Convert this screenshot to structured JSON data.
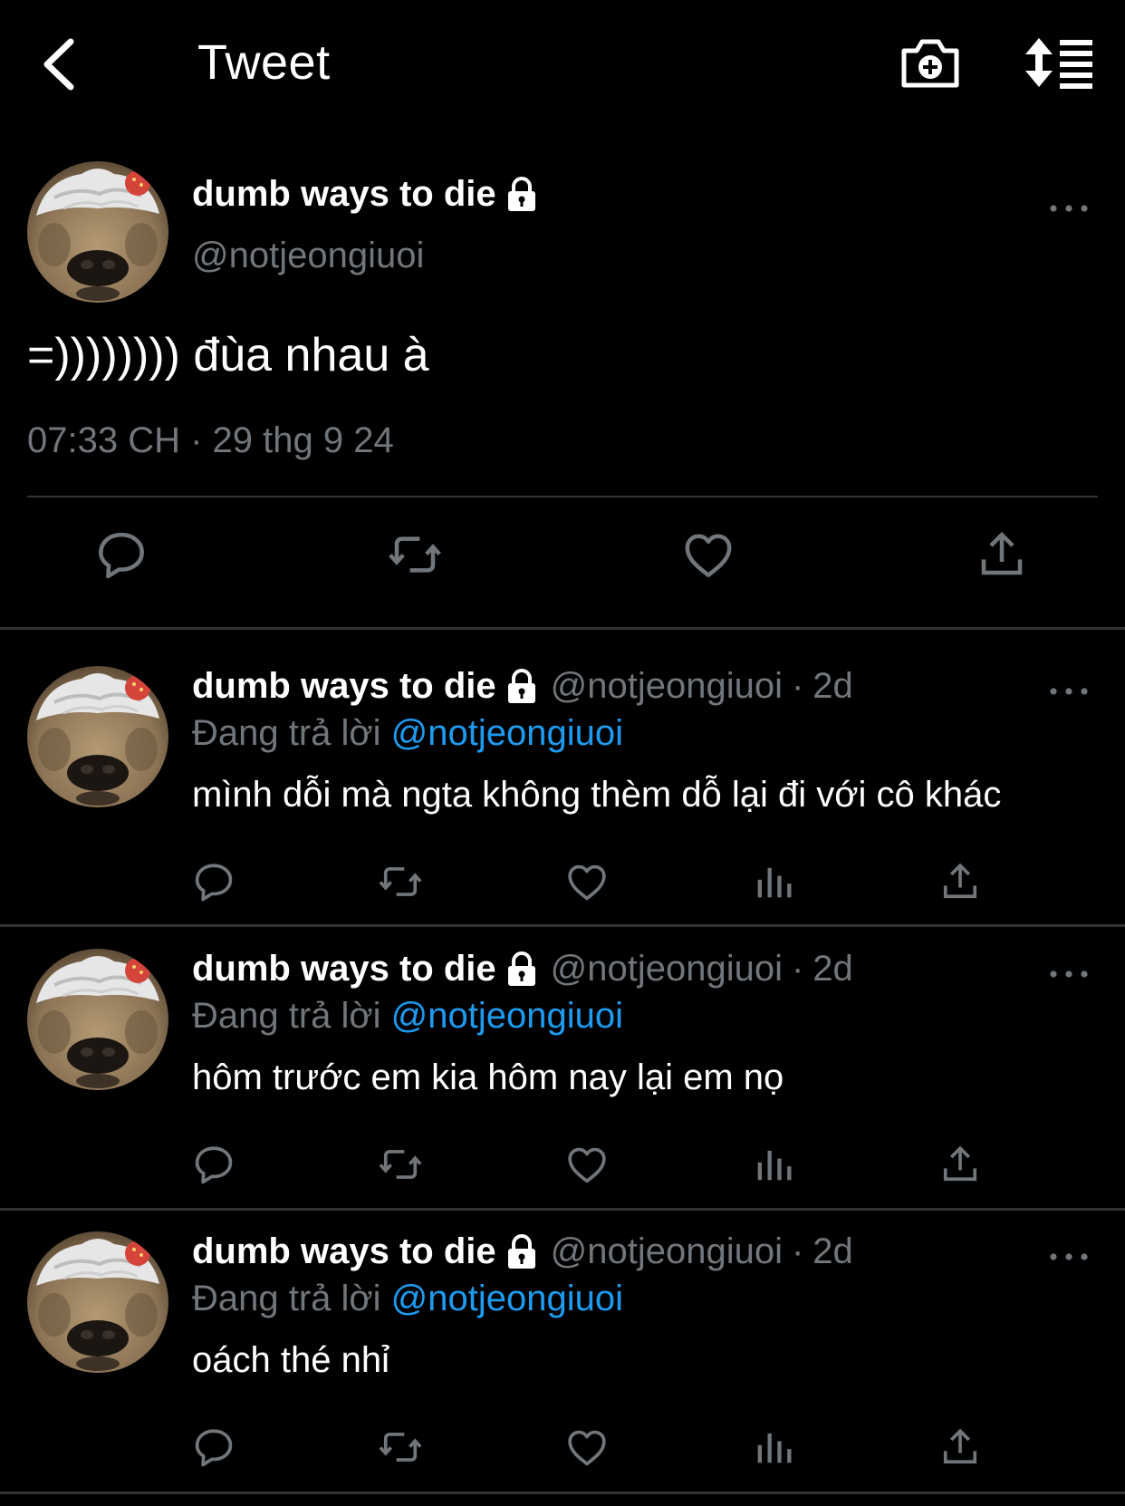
{
  "header": {
    "title": "Tweet",
    "back_icon": "chevron-left-icon",
    "camera_icon": "camera-plus-icon",
    "sort_icon": "sort-list-icon"
  },
  "colors": {
    "background": "#000000",
    "text": "#e7e9ea",
    "muted": "#71767b",
    "accent": "#1d9bf0",
    "divider": "#2f3336"
  },
  "main_tweet": {
    "display_name": "dumb ways to die",
    "handle": "@notjeongiuoi",
    "text": "=)))))))) đùa nhau à",
    "timestamp": "07:33 CH · 29 thg 9 24",
    "actions": [
      "reply",
      "retweet",
      "like",
      "share"
    ]
  },
  "replies": [
    {
      "display_name": "dumb ways to die",
      "handle": "@notjeongiuoi",
      "dot": "·",
      "time": "2d",
      "replying_prefix": "Đang trả lời",
      "replying_to": "@notjeongiuoi",
      "text": "mình dỗi mà ngta không thèm dỗ lại đi với cô khác"
    },
    {
      "display_name": "dumb ways to die",
      "handle": "@notjeongiuoi",
      "dot": "·",
      "time": "2d",
      "replying_prefix": "Đang trả lời",
      "replying_to": "@notjeongiuoi",
      "text": "hôm trước em kia hôm nay lại em nọ"
    },
    {
      "display_name": "dumb ways to die",
      "handle": "@notjeongiuoi",
      "dot": "·",
      "time": "2d",
      "replying_prefix": "Đang trả lời",
      "replying_to": "@notjeongiuoi",
      "text": "oách thé nhỉ"
    }
  ]
}
